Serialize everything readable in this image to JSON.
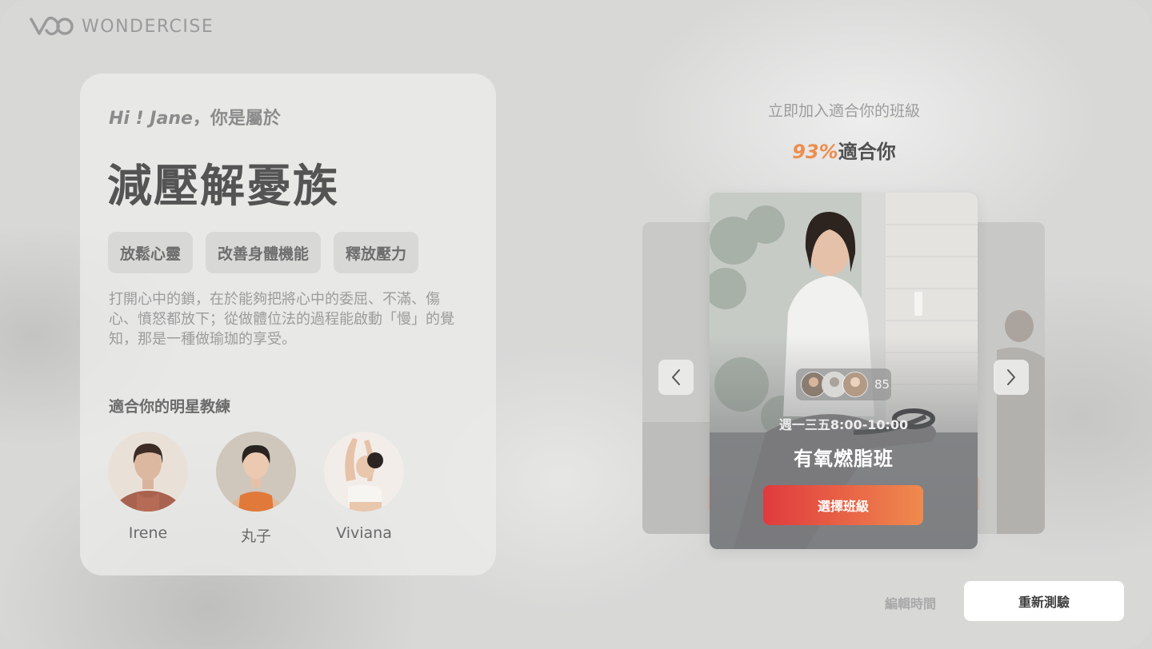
{
  "brand": {
    "name": "WONDERCISE",
    "logo_icon": "wondercise-logo-icon"
  },
  "profile": {
    "greeting_name": "Hi ! Jane",
    "greeting_suffix": "，你是屬於",
    "type_title": "減壓解憂族",
    "tags": [
      "放鬆心靈",
      "改善身體機能",
      "釋放壓力"
    ],
    "description": "打開心中的鎖，在於能夠把將心中的委屈、不滿、傷心、憤怒都放下；從做體位法的過程能啟動「慢」的覺知，那是一種做瑜珈的享受。",
    "coach_heading": "適合你的明星教練",
    "coaches": [
      {
        "name": "Irene"
      },
      {
        "name": "丸子"
      },
      {
        "name": "Viviana"
      }
    ]
  },
  "recommendation": {
    "join_text": "立即加入適合你的班級",
    "match_percent": "93%",
    "match_suffix": "適合你",
    "class": {
      "member_count": "85",
      "schedule": "週一三五8:00-10:00",
      "name": "有氧燃脂班",
      "select_label": "選擇班級"
    },
    "prev_icon": "chevron-left-icon",
    "next_icon": "chevron-right-icon"
  },
  "footer": {
    "edit_time_label": "編輯時間",
    "retest_label": "重新測驗"
  },
  "colors": {
    "accent_orange": "#ee8e4e",
    "button_gradient_start": "#e03a3e",
    "button_gradient_end": "#f08a4e"
  }
}
